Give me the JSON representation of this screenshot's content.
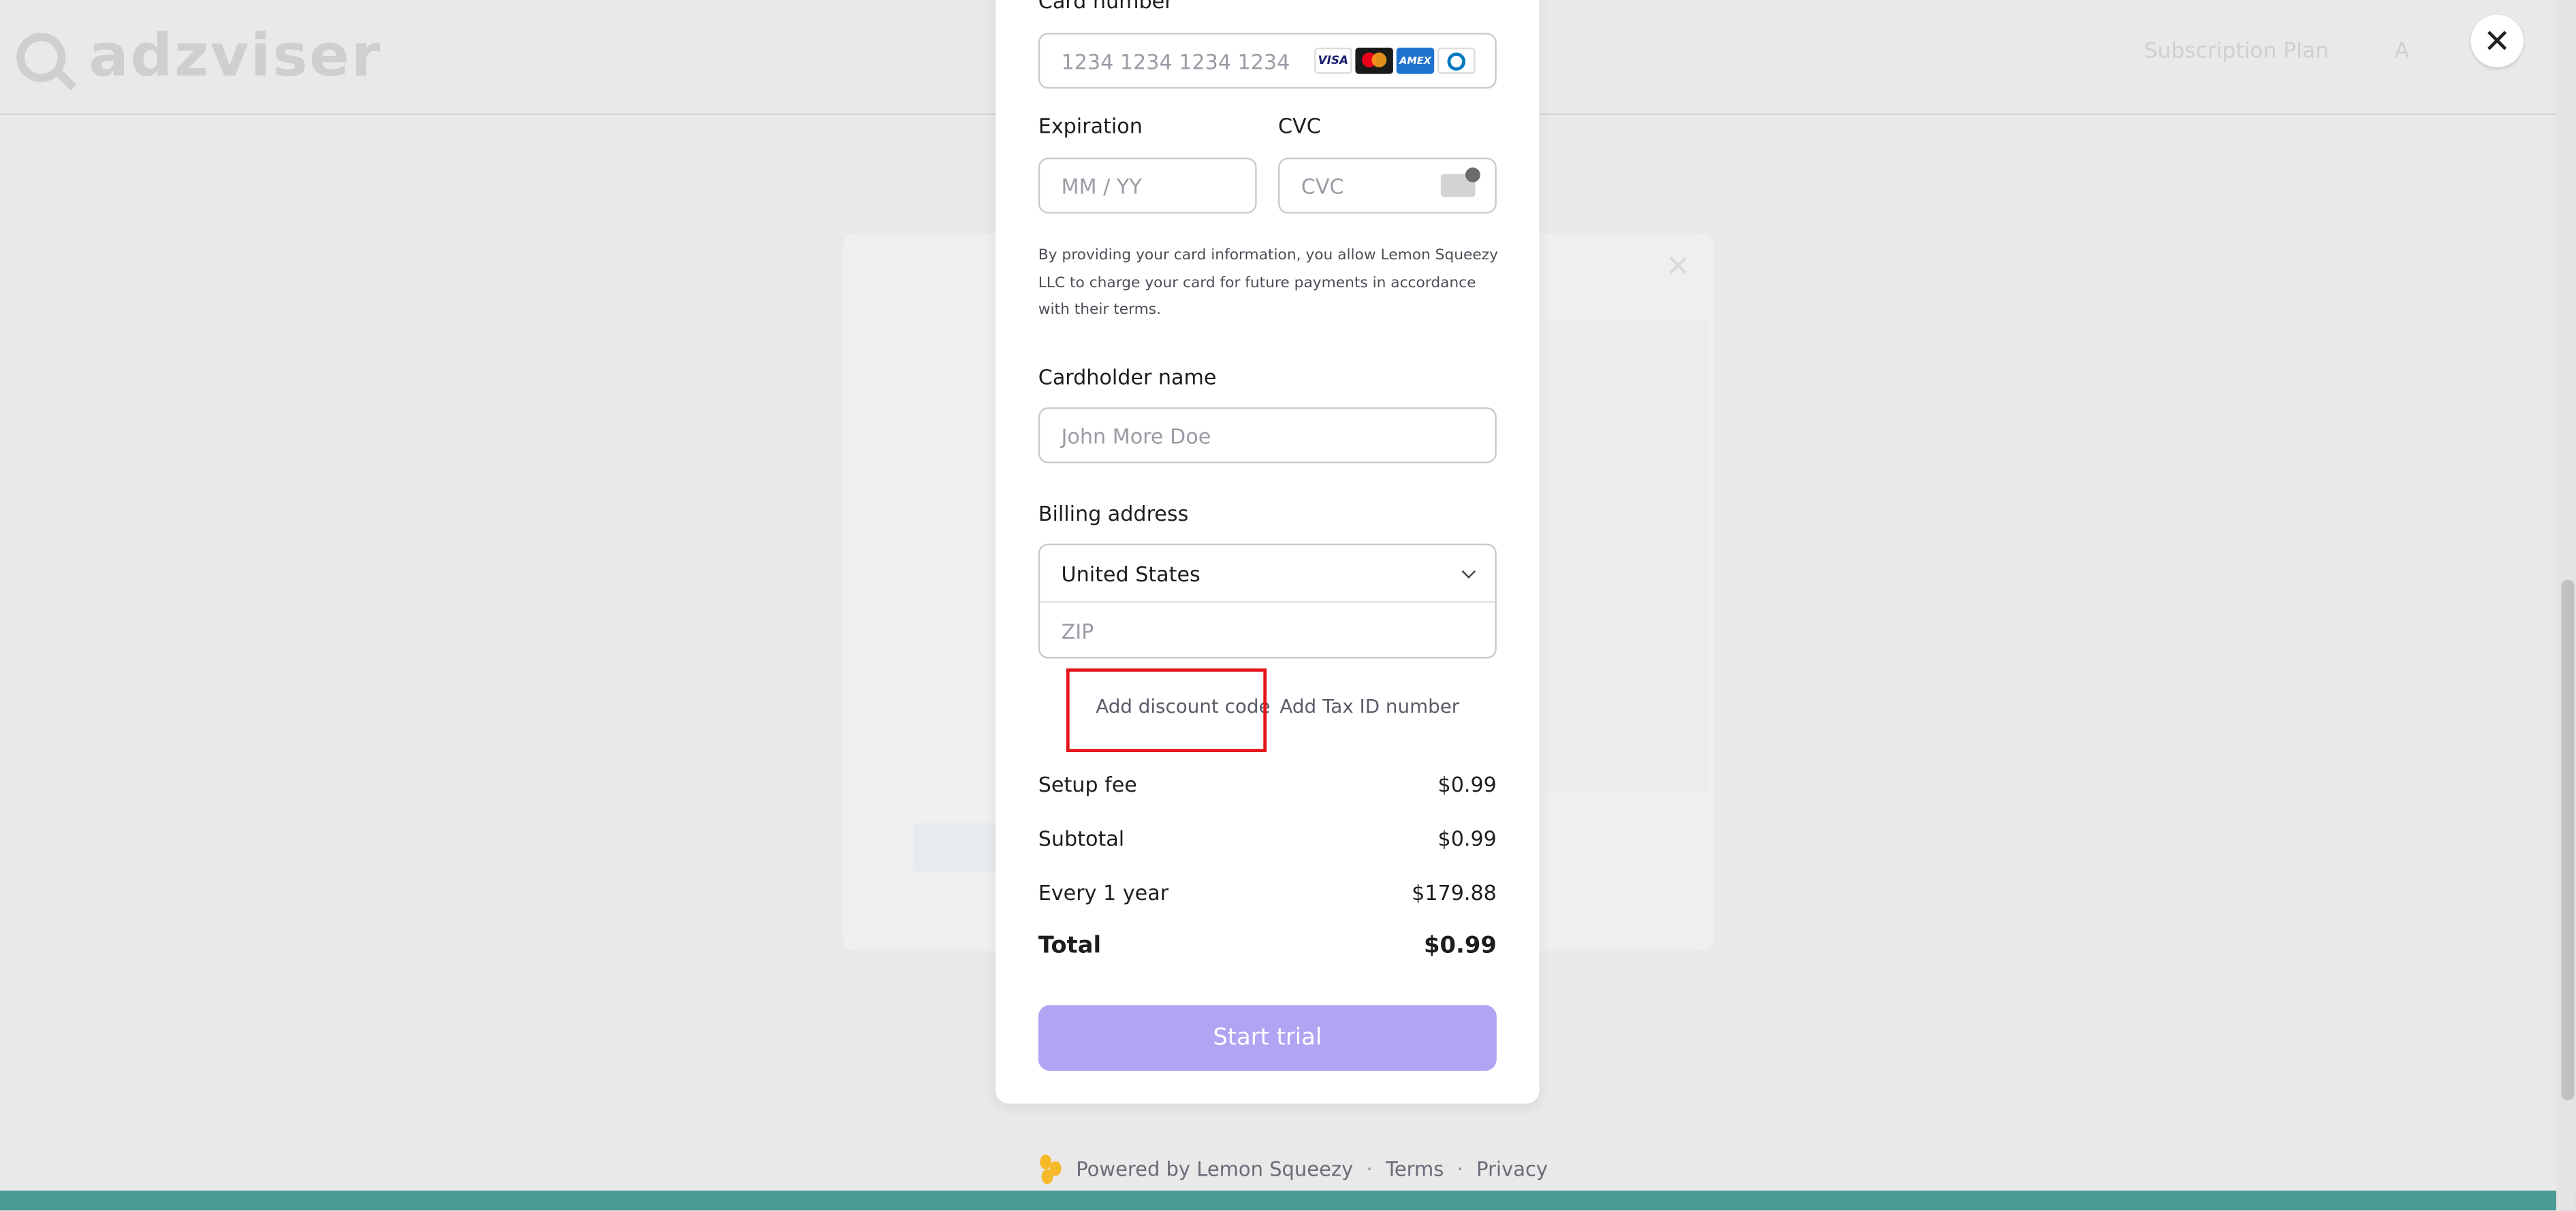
{
  "background": {
    "logo_text": "adzviser",
    "header_right": [
      "Subscription Plan",
      "A"
    ]
  },
  "overlay": {
    "close_symbol": "✕"
  },
  "checkout": {
    "card_number": {
      "label": "Card number",
      "placeholder": "1234 1234 1234 1234",
      "brands": [
        "VISA",
        "mastercard",
        "AMEX",
        "diners"
      ]
    },
    "expiration": {
      "label": "Expiration",
      "placeholder": "MM / YY"
    },
    "cvc": {
      "label": "CVC",
      "placeholder": "CVC"
    },
    "terms_text": "By providing your card information, you allow Lemon Squeezy LLC to charge your card for future payments in accordance with their terms.",
    "cardholder": {
      "label": "Cardholder name",
      "placeholder": "John More Doe"
    },
    "billing": {
      "label": "Billing address",
      "country": "United States",
      "zip_placeholder": "ZIP"
    },
    "links": {
      "discount": "Add discount code",
      "tax": "Add Tax ID number"
    },
    "summary": [
      {
        "label": "Setup fee",
        "value": "$0.99"
      },
      {
        "label": "Subtotal",
        "value": "$0.99"
      },
      {
        "label": "Every 1 year",
        "value": "$179.88"
      }
    ],
    "total": {
      "label": "Total",
      "value": "$0.99"
    },
    "cta_label": "Start trial"
  },
  "footer": {
    "powered": "Powered by Lemon Squeezy",
    "sep": "·",
    "terms": "Terms",
    "privacy": "Privacy"
  },
  "colors": {
    "accent": "#b1a5f3",
    "highlight": "#e3141b",
    "strip": "#4a9a96"
  }
}
